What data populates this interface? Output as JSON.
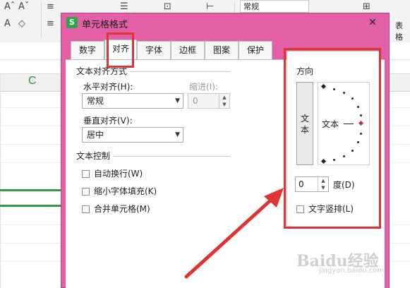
{
  "app": {
    "ribbon_icons": [
      "Aˆ",
      "Aˇ",
      "≡",
      "⊡",
      "◇",
      "≡",
      "☰",
      "⊢"
    ],
    "style_dropdown": "常规",
    "right_label": "表格",
    "column_header": "C"
  },
  "dialog": {
    "title": "单元格格式",
    "logo": "S",
    "close": "✕",
    "tabs": [
      {
        "label": "数字",
        "active": false
      },
      {
        "label": "对齐",
        "active": true
      },
      {
        "label": "字体",
        "active": false
      },
      {
        "label": "边框",
        "active": false
      },
      {
        "label": "图案",
        "active": false
      },
      {
        "label": "保护",
        "active": false
      }
    ],
    "text_alignment": {
      "group_label": "文本对齐方式",
      "horizontal_label": "水平对齐(H):",
      "horizontal_value": "常规",
      "indent_label": "缩进(I):",
      "indent_value": "0",
      "vertical_label": "垂直对齐(V):",
      "vertical_value": "居中"
    },
    "text_control": {
      "group_label": "文本控制",
      "options": [
        "自动换行(W)",
        "缩小字体填充(K)",
        "合并单元格(M)"
      ]
    },
    "orientation": {
      "group_label": "方向",
      "vertical_text_button": "文本",
      "dial_text": "文本",
      "degree_value": "0",
      "degree_label": "度(D)",
      "vertical_text_checkbox": "文字竖排(L)"
    }
  },
  "annotation": {
    "color": "#e03434"
  },
  "watermark": {
    "brand": "Baidu经验",
    "url": "jingyan.baidu.com"
  },
  "colors": {
    "dialog_frame": "#e35fa6",
    "accent_green": "#2f9a48",
    "pointer_red": "#c0303b"
  }
}
